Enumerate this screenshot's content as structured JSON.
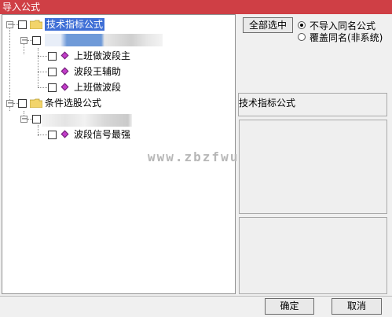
{
  "window": {
    "title": "导入公式"
  },
  "tree": {
    "groups": [
      {
        "label": "技术指标公式",
        "selected": true,
        "items": [
          "上班做波段主",
          "波段王辅助",
          "上班做波段"
        ]
      },
      {
        "label": "条件选股公式",
        "selected": false,
        "items": [
          "波段信号最强"
        ]
      }
    ]
  },
  "watermark": "www.zbzfwu.com",
  "options": {
    "select_all_label": "全部选中",
    "radio_no_import_label": "不导入同名公式",
    "radio_overwrite_label": "覆盖同名(非系统)",
    "selected_option": "no_import"
  },
  "panel": {
    "title": "技术指标公式"
  },
  "footer": {
    "ok_label": "确定",
    "cancel_label": "取消"
  },
  "colors": {
    "titlebar": "#cf3f45",
    "selection": "#3f6fd6",
    "diamond": "#c23cc9",
    "folder": "#f2d46b"
  }
}
